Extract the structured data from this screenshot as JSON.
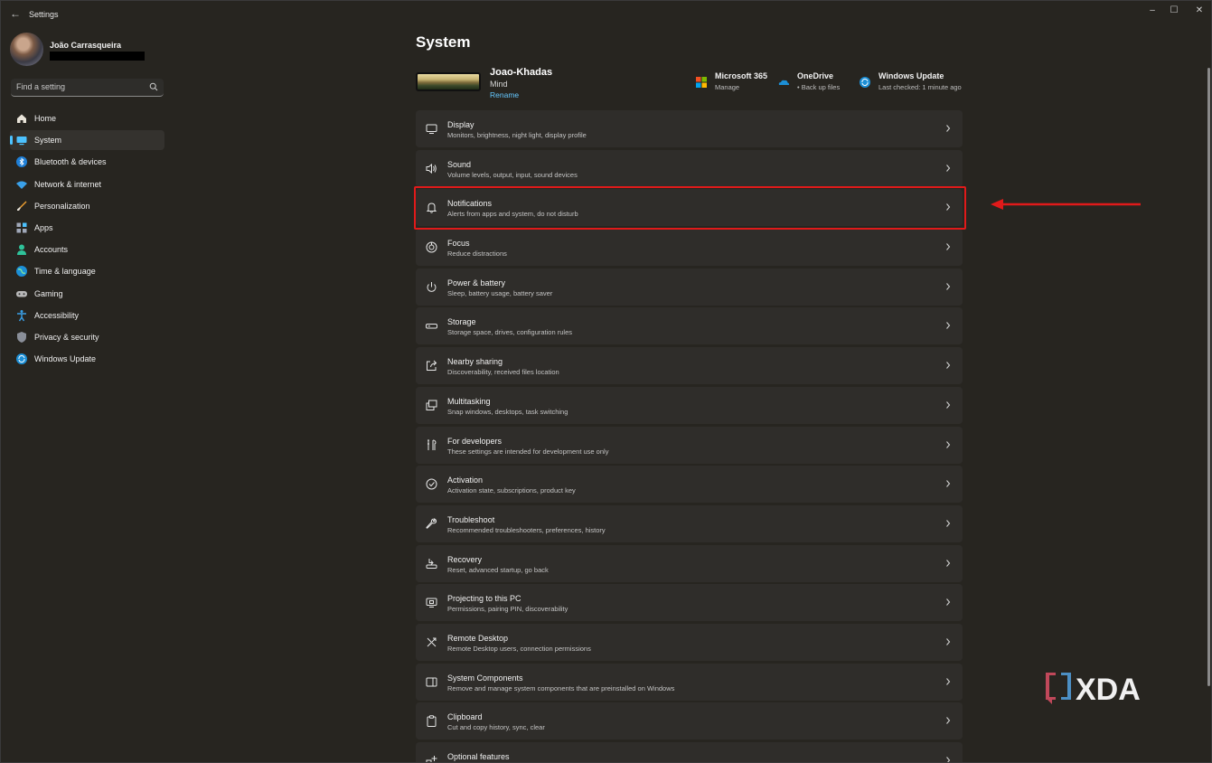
{
  "window": {
    "back_label": "←",
    "title": "Settings",
    "controls": {
      "minimize": "–",
      "maximize": "☐",
      "close": "✕"
    }
  },
  "profile": {
    "name": "João Carrasqueira"
  },
  "search": {
    "placeholder": "Find a setting"
  },
  "sidebar": {
    "items": [
      {
        "label": "Home",
        "icon": "home-icon"
      },
      {
        "label": "System",
        "icon": "system-icon",
        "active": true
      },
      {
        "label": "Bluetooth & devices",
        "icon": "bluetooth-icon"
      },
      {
        "label": "Network & internet",
        "icon": "network-icon"
      },
      {
        "label": "Personalization",
        "icon": "brush-icon"
      },
      {
        "label": "Apps",
        "icon": "apps-icon"
      },
      {
        "label": "Accounts",
        "icon": "accounts-icon"
      },
      {
        "label": "Time & language",
        "icon": "globe-icon"
      },
      {
        "label": "Gaming",
        "icon": "gamepad-icon"
      },
      {
        "label": "Accessibility",
        "icon": "accessibility-icon"
      },
      {
        "label": "Privacy & security",
        "icon": "shield-icon"
      },
      {
        "label": "Windows Update",
        "icon": "update-icon"
      }
    ]
  },
  "main": {
    "title": "System",
    "device": {
      "name": "Joao-Khadas",
      "model": "Mind",
      "rename": "Rename"
    },
    "tiles": [
      {
        "title": "Microsoft 365",
        "subtitle": "Manage",
        "icon": "microsoft-365-icon"
      },
      {
        "title": "OneDrive",
        "subtitle": "• Back up files",
        "icon": "onedrive-icon"
      },
      {
        "title": "Windows Update",
        "subtitle": "Last checked: 1 minute ago",
        "icon": "windows-update-icon"
      }
    ],
    "settings": [
      {
        "title": "Display",
        "subtitle": "Monitors, brightness, night light, display profile",
        "icon": "display-icon"
      },
      {
        "title": "Sound",
        "subtitle": "Volume levels, output, input, sound devices",
        "icon": "speaker-icon"
      },
      {
        "title": "Notifications",
        "subtitle": "Alerts from apps and system, do not disturb",
        "icon": "bell-icon"
      },
      {
        "title": "Focus",
        "subtitle": "Reduce distractions",
        "icon": "focus-icon"
      },
      {
        "title": "Power & battery",
        "subtitle": "Sleep, battery usage, battery saver",
        "icon": "power-icon"
      },
      {
        "title": "Storage",
        "subtitle": "Storage space, drives, configuration rules",
        "icon": "storage-icon"
      },
      {
        "title": "Nearby sharing",
        "subtitle": "Discoverability, received files location",
        "icon": "share-icon"
      },
      {
        "title": "Multitasking",
        "subtitle": "Snap windows, desktops, task switching",
        "icon": "multitask-icon"
      },
      {
        "title": "For developers",
        "subtitle": "These settings are intended for development use only",
        "icon": "developer-icon"
      },
      {
        "title": "Activation",
        "subtitle": "Activation state, subscriptions, product key",
        "icon": "activation-icon"
      },
      {
        "title": "Troubleshoot",
        "subtitle": "Recommended troubleshooters, preferences, history",
        "icon": "wrench-icon"
      },
      {
        "title": "Recovery",
        "subtitle": "Reset, advanced startup, go back",
        "icon": "recovery-icon"
      },
      {
        "title": "Projecting to this PC",
        "subtitle": "Permissions, pairing PIN, discoverability",
        "icon": "projector-icon"
      },
      {
        "title": "Remote Desktop",
        "subtitle": "Remote Desktop users, connection permissions",
        "icon": "remote-desktop-icon"
      },
      {
        "title": "System Components",
        "subtitle": "Remove and manage system components that are preinstalled on Windows",
        "icon": "components-icon"
      },
      {
        "title": "Clipboard",
        "subtitle": "Cut and copy history, sync, clear",
        "icon": "clipboard-icon"
      },
      {
        "title": "Optional features",
        "subtitle": "",
        "icon": "optional-features-icon"
      }
    ]
  },
  "watermark": {
    "text": "XDA"
  },
  "colors": {
    "accent": "#4cc2ff",
    "link": "#65c8ff",
    "highlight": "#e01a1a",
    "background": "#272520",
    "card": "#2f2d2a"
  }
}
